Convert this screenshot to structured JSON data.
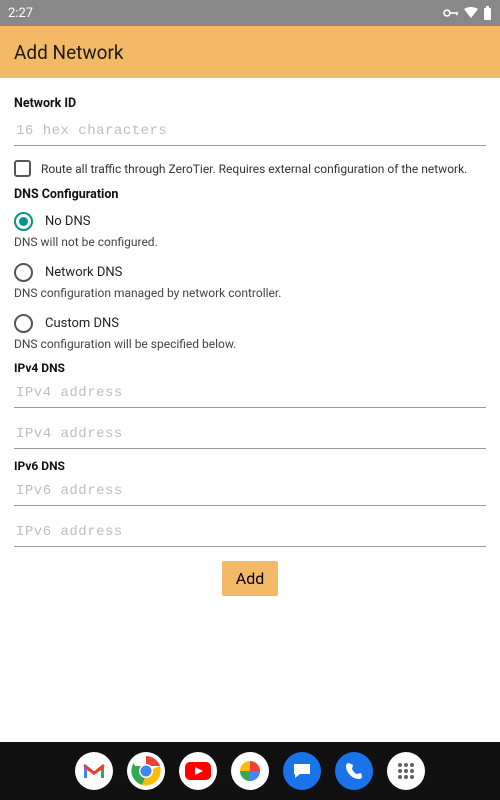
{
  "status_bar": {
    "time": "2:27"
  },
  "header": {
    "title": "Add Network"
  },
  "form": {
    "network_id": {
      "label": "Network ID",
      "placeholder": "16 hex characters",
      "value": ""
    },
    "route_all": {
      "label": "Route all traffic through ZeroTier. Requires external configuration of the network.",
      "checked": false
    },
    "dns_config": {
      "label": "DNS Configuration",
      "options": [
        {
          "id": "no-dns",
          "label": "No DNS",
          "desc": "DNS will not be configured.",
          "selected": true
        },
        {
          "id": "network-dns",
          "label": "Network DNS",
          "desc": "DNS configuration managed by network controller.",
          "selected": false
        },
        {
          "id": "custom-dns",
          "label": "Custom DNS",
          "desc": "DNS configuration will be specified below.",
          "selected": false
        }
      ]
    },
    "ipv4_dns": {
      "label": "IPv4 DNS",
      "placeholder": "IPv4 address"
    },
    "ipv6_dns": {
      "label": "IPv6 DNS",
      "placeholder": "IPv6 address"
    },
    "add_button": "Add"
  }
}
